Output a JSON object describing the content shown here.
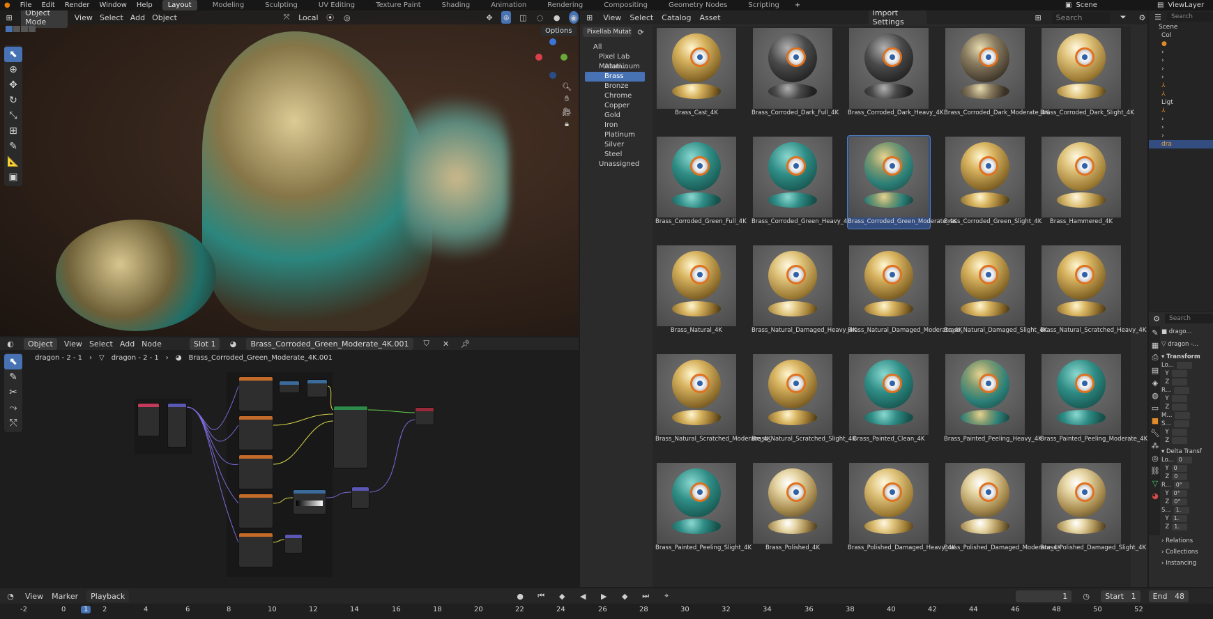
{
  "topbar": {
    "menus": [
      "File",
      "Edit",
      "Render",
      "Window",
      "Help"
    ],
    "workspaces": [
      "Layout",
      "Modeling",
      "Sculpting",
      "UV Editing",
      "Texture Paint",
      "Shading",
      "Animation",
      "Rendering",
      "Compositing",
      "Geometry Nodes",
      "Scripting"
    ],
    "active_workspace": "Layout",
    "add": "+",
    "scene": "Scene",
    "view_layer": "ViewLayer"
  },
  "viewport": {
    "mode": "Object Mode",
    "menus": [
      "View",
      "Select",
      "Add",
      "Object"
    ],
    "transform": "Local",
    "options": "Options"
  },
  "node_editor": {
    "type": "Object",
    "menus": [
      "View",
      "Select",
      "Add",
      "Node"
    ],
    "slot": "Slot 1",
    "material": "Brass_Corroded_Green_Moderate_4K.001",
    "breadcrumb": [
      "dragon - 2 - 1",
      "dragon - 2 - 1",
      "Brass_Corroded_Green_Moderate_4K.001"
    ]
  },
  "asset_browser": {
    "menus": [
      "View",
      "Select",
      "Catalog",
      "Asset"
    ],
    "import_settings": "Import Settings",
    "search_placeholder": "Search",
    "library": "Pixellab Mutating ...",
    "catalog_tree": {
      "all": "All",
      "root": "Pixel Lab Mutati...",
      "items": [
        "Aluminum",
        "Brass",
        "Bronze",
        "Chrome",
        "Copper",
        "Gold",
        "Iron",
        "Platinum",
        "Silver",
        "Steel"
      ],
      "selected": "Brass",
      "unassigned": "Unassigned"
    },
    "assets": [
      {
        "name": "Brass_Cast_4K",
        "look": "gold"
      },
      {
        "name": "Brass_Corroded_Dark_Full_4K",
        "look": "dark"
      },
      {
        "name": "Brass_Corroded_Dark_Heavy_4K",
        "look": "dark"
      },
      {
        "name": "Brass_Corroded_Dark_Moderate_4K",
        "look": "darkgold"
      },
      {
        "name": "Brass_Corroded_Dark_Slight_4K",
        "look": "gold3"
      },
      {
        "name": "Brass_Corroded_Green_Full_4K",
        "look": "teal"
      },
      {
        "name": "Brass_Corroded_Green_Heavy_4K",
        "look": "teal"
      },
      {
        "name": "Brass_Corroded_Green_Moderate_4K",
        "look": "tealgold",
        "selected": true
      },
      {
        "name": "Brass_Corroded_Green_Slight_4K",
        "look": "gold"
      },
      {
        "name": "Brass_Hammered_4K",
        "look": "gold3"
      },
      {
        "name": "Brass_Natural_4K",
        "look": "gold"
      },
      {
        "name": "Brass_Natural_Damaged_Heavy_4K",
        "look": "gold3"
      },
      {
        "name": "Brass_Natural_Damaged_Moderate_4K",
        "look": "gold"
      },
      {
        "name": "Brass_Natural_Damaged_Slight_4K",
        "look": "gold"
      },
      {
        "name": "Brass_Natural_Scratched_Heavy_4K",
        "look": "gold"
      },
      {
        "name": "Brass_Natural_Scratched_Moderate_4K",
        "look": "gold"
      },
      {
        "name": "Brass_Natural_Scratched_Slight_4K",
        "look": "gold"
      },
      {
        "name": "Brass_Painted_Clean_4K",
        "look": "teal"
      },
      {
        "name": "Brass_Painted_Peeling_Heavy_4K",
        "look": "tealgold"
      },
      {
        "name": "Brass_Painted_Peeling_Moderate_4K",
        "look": "teal"
      },
      {
        "name": "Brass_Painted_Peeling_Slight_4K",
        "look": "teal"
      },
      {
        "name": "Brass_Polished_4K",
        "look": "gold2"
      },
      {
        "name": "Brass_Polished_Damaged_Heavy_4K",
        "look": "gold3"
      },
      {
        "name": "Brass_Polished_Damaged_Moderate_4K",
        "look": "gold2"
      },
      {
        "name": "Brass_Polished_Damaged_Slight_4K",
        "look": "gold2"
      }
    ]
  },
  "outliner": {
    "search_placeholder": "Search",
    "scene": "Scene",
    "col": "Col",
    "lig": "Ligt",
    "dra": "dra"
  },
  "properties": {
    "search_placeholder": "Search",
    "object_name": "drago...",
    "data_name": "dragon -...",
    "transform": "Transform",
    "loc_label": "Lo...",
    "rot_label": "R...",
    "mode_label": "M...",
    "scale_label": "S...",
    "axes": [
      "Y",
      "Z"
    ],
    "delta": "Delta Transf",
    "delta_values": [
      "0",
      "0",
      "0"
    ],
    "delta_rot": [
      "0°",
      "0°",
      "0°"
    ],
    "delta_scale": [
      "1.",
      "1.",
      "1."
    ],
    "relations": "Relations",
    "collections": "Collections",
    "instancing": "Instancing"
  },
  "timeline": {
    "menus": [
      "View",
      "Marker"
    ],
    "playback": "Playback",
    "current_frame": "1",
    "start_label": "Start",
    "start": "1",
    "end_label": "End",
    "end": "48",
    "ruler": [
      "-2",
      "0",
      "1",
      "2",
      "4",
      "6",
      "8",
      "10",
      "12",
      "14",
      "16",
      "18",
      "20",
      "22",
      "24",
      "26",
      "28",
      "30",
      "32",
      "34",
      "36",
      "38",
      "40",
      "42",
      "44",
      "46",
      "48",
      "50",
      "52"
    ]
  },
  "colors": {
    "accent": "#4772b3",
    "bg": "#1d1d1d",
    "header": "#232323",
    "panel": "#2a2a2a"
  }
}
